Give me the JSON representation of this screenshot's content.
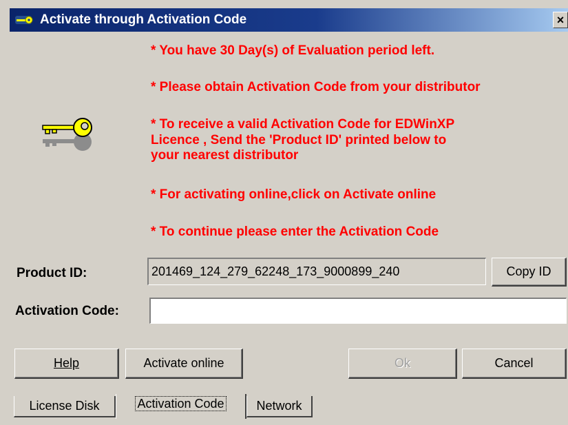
{
  "window": {
    "title": "Activate through Activation Code",
    "close_label": "×"
  },
  "messages": [
    "* You have 30 Day(s) of Evaluation period left.",
    "* Please obtain Activation Code from your distributor",
    "* To receive a valid Activation Code for EDWinXP",
    " Licence , Send the 'Product ID' printed below to",
    "your nearest distributor",
    "* For activating online,click on Activate online",
    "* To continue please enter the Activation Code"
  ],
  "product_id": {
    "label": "Product ID:",
    "value": "201469_124_279_62248_173_9000899_240",
    "copy_button": "Copy ID"
  },
  "activation_code": {
    "label": "Activation Code:",
    "value": ""
  },
  "buttons": {
    "help": "Help",
    "activate_online": "Activate online",
    "ok": "Ok",
    "cancel": "Cancel"
  },
  "tabs": [
    {
      "label": "License Disk",
      "active": false
    },
    {
      "label": "Activation Code",
      "active": true
    },
    {
      "label": "Network",
      "active": false
    }
  ],
  "colors": {
    "message_text": "#ff0000",
    "titlebar_start": "#0a246a",
    "titlebar_end": "#a6caf0",
    "dialog_bg": "#d4d0c8"
  },
  "icons": {
    "title": "key-icon",
    "body": "key-icon",
    "close": "close-icon"
  }
}
